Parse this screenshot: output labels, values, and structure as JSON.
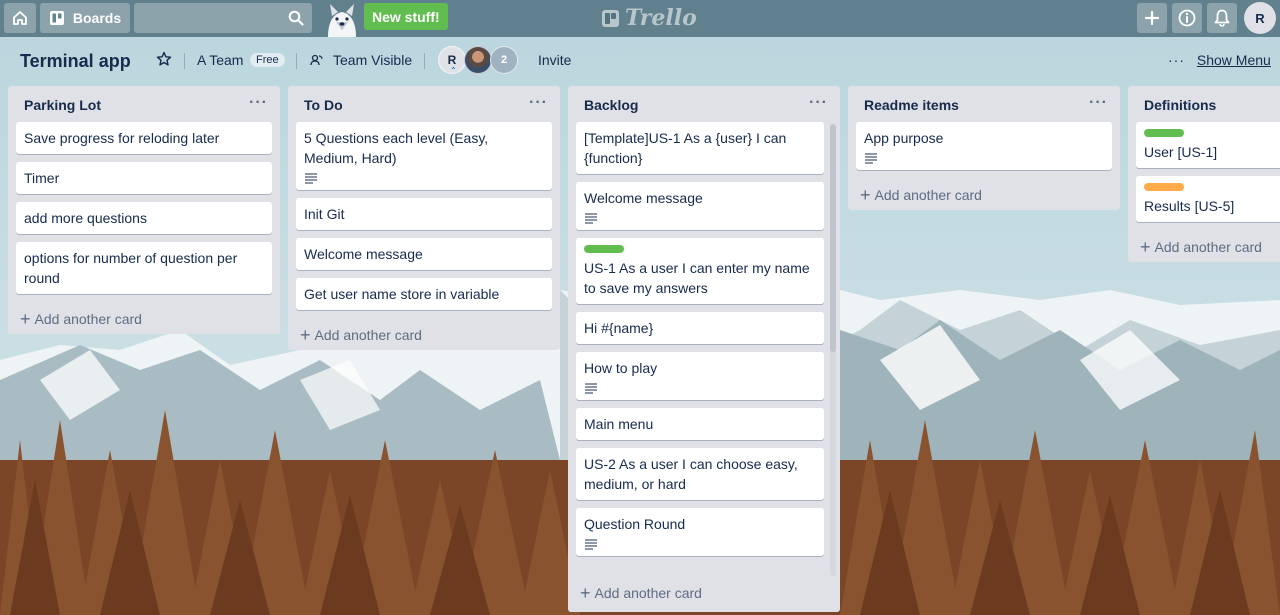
{
  "topbar": {
    "home_icon": "home-icon",
    "boards_label": "Boards",
    "search_placeholder": "",
    "new_stuff_label": "New stuff!",
    "logo_text": "Trello",
    "add_icon": "plus-icon",
    "info_icon": "info-icon",
    "bell_icon": "bell-icon",
    "avatar_initial": "R"
  },
  "board": {
    "title": "Terminal app",
    "team": "A Team",
    "plan_badge": "Free",
    "visibility": "Team Visible",
    "member_initial": "R",
    "extra_members": "2",
    "invite_label": "Invite",
    "menu_dots": "···",
    "show_menu_label": "Show Menu"
  },
  "lists": [
    {
      "title": "Parking Lot",
      "cards": [
        {
          "text": "Save progress for reloding later",
          "label_color": null,
          "has_desc": false
        },
        {
          "text": "Timer",
          "label_color": null,
          "has_desc": false
        },
        {
          "text": "add more questions",
          "label_color": null,
          "has_desc": false
        },
        {
          "text": "options for number of question per round",
          "label_color": null,
          "has_desc": false
        }
      ],
      "add_label": "Add another card"
    },
    {
      "title": "To Do",
      "cards": [
        {
          "text": "5 Questions each level (Easy, Medium, Hard)",
          "label_color": null,
          "has_desc": true
        },
        {
          "text": "Init Git",
          "label_color": null,
          "has_desc": false
        },
        {
          "text": "Welcome message",
          "label_color": null,
          "has_desc": false
        },
        {
          "text": "Get user name store in variable",
          "label_color": null,
          "has_desc": false
        }
      ],
      "add_label": "Add another card"
    },
    {
      "title": "Backlog",
      "cards": [
        {
          "text": "[Template]US-1 As a {user} I can {function}",
          "label_color": null,
          "has_desc": false
        },
        {
          "text": "Welcome message",
          "label_color": null,
          "has_desc": true
        },
        {
          "text": "US-1 As a user I can enter my name to save my answers",
          "label_color": "#61bd4f",
          "has_desc": false
        },
        {
          "text": "Hi #{name}",
          "label_color": null,
          "has_desc": false
        },
        {
          "text": "How to play",
          "label_color": null,
          "has_desc": true
        },
        {
          "text": "Main menu",
          "label_color": null,
          "has_desc": false
        },
        {
          "text": "US-2 As a user I can choose easy, medium, or hard",
          "label_color": null,
          "has_desc": false
        },
        {
          "text": "Question Round",
          "label_color": null,
          "has_desc": true
        }
      ],
      "add_label": "Add another card"
    },
    {
      "title": "Readme items",
      "cards": [
        {
          "text": "App purpose",
          "label_color": null,
          "has_desc": true
        }
      ],
      "add_label": "Add another card"
    },
    {
      "title": "Definitions",
      "cards": [
        {
          "text": "User [US-1]",
          "label_color": "#61bd4f",
          "has_desc": false
        },
        {
          "text": "Results [US-5]",
          "label_color": "#ffab4a",
          "has_desc": false
        }
      ],
      "add_label": "Add another card"
    }
  ],
  "colors": {
    "topbar": "#466876",
    "list_bg": "#dfe1e6",
    "new_stuff": "#61bd4f",
    "label_green": "#61bd4f",
    "label_orange": "#ffab4a"
  }
}
